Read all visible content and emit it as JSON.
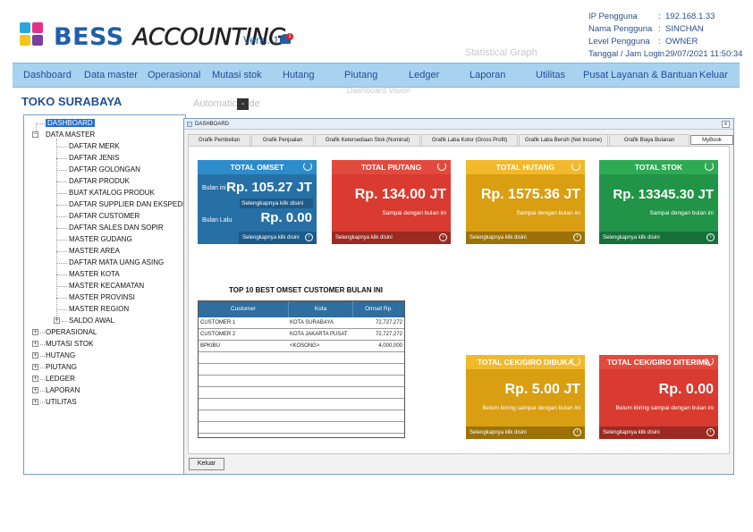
{
  "header": {
    "brand_bold": "BESS",
    "brand_styled": "ACCOUNTING",
    "version": "Versi. 1.",
    "notification_count": "1",
    "logo_colors": [
      "#2aa6de",
      "#e6318a",
      "#f5c51f",
      "#7a3fa0"
    ],
    "info": [
      {
        "label": "IP Pengguna",
        "value": "192.168.1.33"
      },
      {
        "label": "Nama Pengguna",
        "value": "SINCHAN"
      },
      {
        "label": "Level Pengguna",
        "value": "OWNER"
      },
      {
        "label": "Tanggal / Jam Login",
        "value": "29/07/2021 11:50:34"
      }
    ],
    "watermarks": [
      "Statistical Graph",
      "Dashboard Vision"
    ]
  },
  "menu": [
    "Dashboard",
    "Data master",
    "Operasional",
    "Mutasi stok",
    "Hutang",
    "Piutang",
    "Ledger",
    "Laporan",
    "Utilitas",
    "Pusat Layanan & Bantuan",
    "Keluar"
  ],
  "store_name": "TOKO SURABAYA",
  "automatic_label": "Automatic Hide",
  "minus_label": "-",
  "tree": {
    "dashboard": "DASHBOARD",
    "data_master": "DATA MASTER",
    "data_master_children": [
      "DAFTAR MERK",
      "DAFTAR JENIS",
      "DAFTAR GOLONGAN",
      "DAFTAR PRODUK",
      "BUAT KATALOG PRODUK",
      "DAFTAR SUPPLIER DAN EKSPEDISI",
      "DAFTAR CUSTOMER",
      "DAFTAR SALES DAN SOPIR",
      "MASTER GUDANG",
      "MASTER AREA",
      "DAFTAR MATA UANG ASING",
      "MASTER KOTA",
      "MASTER KECAMATAN",
      "MASTER PROVINSI",
      "MASTER REGION"
    ],
    "saldo_awal": "SALDO AWAL",
    "top_level": [
      "OPERASIONAL",
      "MUTASI STOK",
      "HUTANG",
      "PIUTANG",
      "LEDGER",
      "LAPORAN",
      "UTILITAS"
    ]
  },
  "window": {
    "title": "DASHBOARD",
    "close": "x",
    "tabs": [
      "Grafik Pembelian",
      "Grafik Penjualan",
      "Grafik Ketersediaan Stok (Nominal)",
      "Grafik Laba Kotor (Gross Profit)",
      "Grafik Laba Bersih (Net Income)",
      "Grafik Biaya Bulanan",
      "MyBook"
    ],
    "active_tab": "MyBook"
  },
  "cards": {
    "omset": {
      "title": "TOTAL OMSET",
      "label_current": "Bulan ini",
      "value_current": "Rp. 105.27 JT",
      "link_current": "Selengkapnya klik disini",
      "label_prev": "Bulan Lalu",
      "value_prev": "Rp. 0.00",
      "link_prev": "Selengkapnya klik disini",
      "color_header": "#2c8ccc",
      "color_body": "#2670a6",
      "color_footer": "#1d5a88"
    },
    "piutang": {
      "title": "TOTAL PIUTANG",
      "value": "Rp. 134.00 JT",
      "sub": "Sampai dengan bulan ini",
      "link": "Selengkapnya klik disini",
      "color_header": "#e24a3e",
      "color_body": "#d93b30",
      "color_footer": "#9c2a22"
    },
    "hutang": {
      "title": "TOTAL HUTANG",
      "value": "Rp. 1575.36 JT",
      "sub": "Sampai dengan bulan ini",
      "link": "Selengkapnya klik disini",
      "color_header": "#f2b92a",
      "color_body": "#d99e12",
      "color_footer": "#9c7208"
    },
    "stok": {
      "title": "TOTAL STOK",
      "value": "Rp. 13345.30 JT",
      "sub": "Sampai dengan bulan ini",
      "link": "Selengkapnya klik disini",
      "color_header": "#2eaa55",
      "color_body": "#229447",
      "color_footer": "#17703a"
    },
    "cek_dibuka": {
      "title": "TOTAL CEK/GIRO DIBUKA",
      "value": "Rp. 5.00 JT",
      "sub": "Belum kliring sampai dengan bulan ini",
      "link": "Selengkapnya klik disini",
      "color_header": "#f2b92a",
      "color_body": "#d99e12",
      "color_footer": "#9c7208"
    },
    "cek_diterima": {
      "title": "TOTAL CEK/GIRO DITERIMA",
      "value": "Rp. 0.00",
      "sub": "Belum kliring sampai dengan bulan ini",
      "link": "Selengkapnya klik disini",
      "color_header": "#e24a3e",
      "color_body": "#d93b30",
      "color_footer": "#9c2a22"
    }
  },
  "top_customers": {
    "title": "TOP 10 BEST OMSET CUSTOMER BULAN INI",
    "columns": [
      "Customer",
      "Kota",
      "Omset Rp."
    ],
    "rows": [
      [
        "CUSTOMER 1",
        "KOTA SURABAYA",
        "72,727,272"
      ],
      [
        "CUSTOMER 2",
        "KOTA JAKARTA PUSAT",
        "72,727,272"
      ],
      [
        "BPKIBU",
        "<KOSONG>",
        "4,000,000"
      ]
    ],
    "empty_rows": 7
  },
  "keluar_button": "Keluar"
}
